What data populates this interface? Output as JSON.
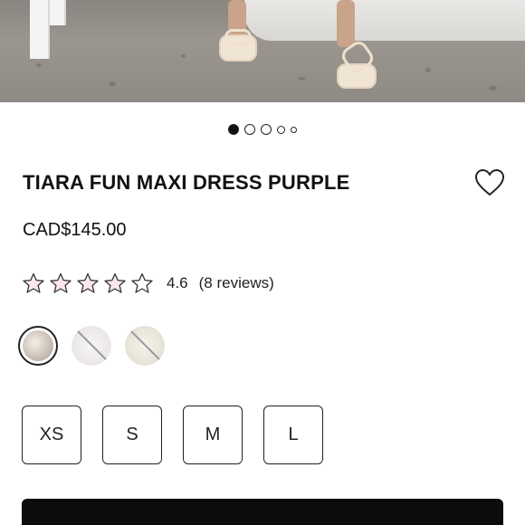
{
  "product": {
    "title": "TIARA FUN MAXI DRESS PURPLE",
    "price": "CAD$145.00",
    "image_alt": "product photo showing sandals",
    "carousel": {
      "count": 5,
      "active_index": 0
    }
  },
  "rating": {
    "value": "4.6",
    "count_label": "(8 reviews)",
    "stars": 5,
    "star_fill_color": "#fde6ef",
    "star_stroke_color": "#333333"
  },
  "swatches": [
    {
      "name": "purple",
      "selected": true,
      "available": true,
      "color": "#d8cfc7"
    },
    {
      "name": "variant-2",
      "selected": false,
      "available": false,
      "color": "#f0eef0"
    },
    {
      "name": "variant-3",
      "selected": false,
      "available": false,
      "color": "#ece9df"
    }
  ],
  "sizes": [
    "XS",
    "S",
    "M",
    "L"
  ],
  "icons": {
    "wishlist": "heart-icon",
    "star": "star-icon"
  },
  "colors": {
    "primary_button": "#0c0c0c",
    "text": "#111111"
  }
}
